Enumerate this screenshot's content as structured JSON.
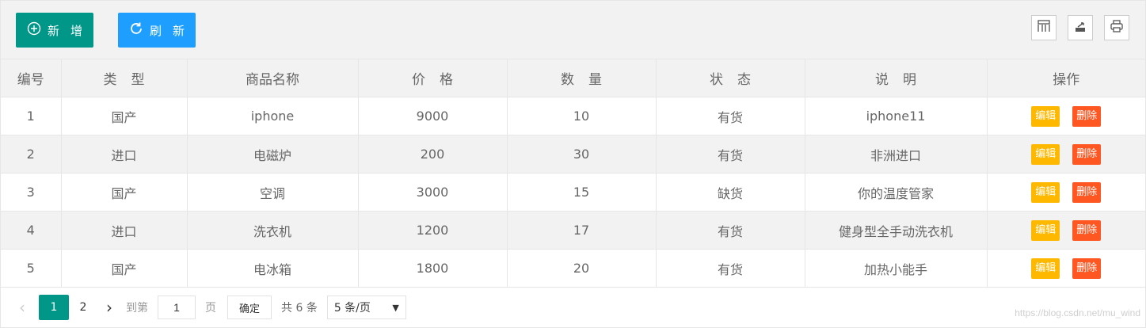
{
  "toolbar": {
    "add_label": "新增",
    "refresh_label": "刷新"
  },
  "table": {
    "headers": [
      "编号",
      "类型",
      "商品名称",
      "价格",
      "数量",
      "状态",
      "说明",
      "操作"
    ],
    "rows": [
      [
        "1",
        "国产",
        "iphone",
        "9000",
        "10",
        "有货",
        "iphone11"
      ],
      [
        "2",
        "进口",
        "电磁炉",
        "200",
        "30",
        "有货",
        "非洲进口"
      ],
      [
        "3",
        "国产",
        "空调",
        "3000",
        "15",
        "缺货",
        "你的温度管家"
      ],
      [
        "4",
        "进口",
        "洗衣机",
        "1200",
        "17",
        "有货",
        "健身型全手动洗衣机"
      ],
      [
        "5",
        "国产",
        "电冰箱",
        "1800",
        "20",
        "有货",
        "加热小能手"
      ]
    ],
    "edit_label": "编辑",
    "delete_label": "删除"
  },
  "pagination": {
    "pages": [
      "1",
      "2"
    ],
    "goto_label": "到第",
    "goto_value": "1",
    "page_unit": "页",
    "confirm_label": "确定",
    "total_label": "共 6 条",
    "page_size": "5 条/页"
  },
  "watermark": "https://blog.csdn.net/mu_wind",
  "colors": {
    "primary": "#009688",
    "refresh": "#1e9fff",
    "edit": "#ffb800",
    "delete": "#ff5722"
  }
}
